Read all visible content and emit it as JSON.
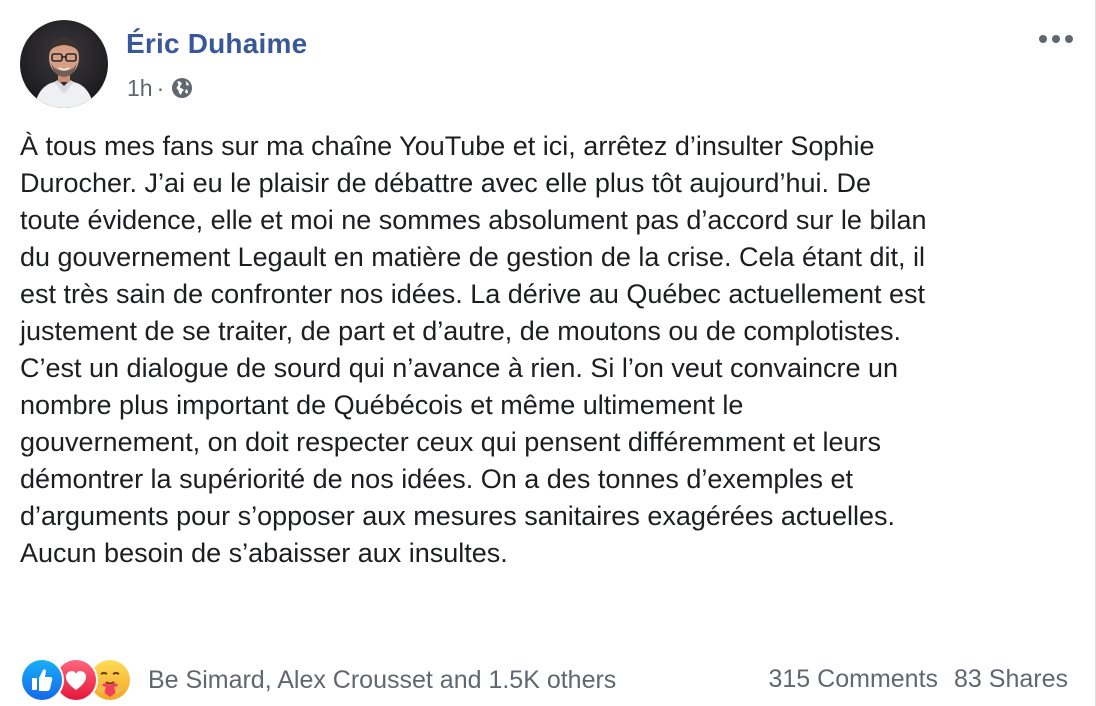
{
  "post": {
    "author": "Éric Duhaime",
    "time": "1h",
    "separator": "·",
    "privacy_icon": "globe-icon",
    "more_icon": "ellipsis-icon",
    "text": "À tous mes fans sur ma chaîne YouTube et ici, arrêtez d’insulter Sophie\nDurocher. J’ai eu le plaisir de débattre avec elle plus tôt aujourd’hui. De\ntoute évidence, elle et moi ne sommes absolument pas d’accord sur le bilan\ndu gouvernement Legault en matière de gestion de la crise. Cela étant dit, il\nest très sain de confronter nos idées. La dérive au Québec actuellement est\njustement de se traiter, de part et d’autre, de moutons ou de complotistes.\nC’est un dialogue de sourd qui n’avance à rien. Si l’on veut convaincre un\nnombre plus important de Québécois et même ultimement le\ngouvernement, on doit respecter ceux qui pensent différemment et leurs\ndémontrer la supériorité de nos idées. On a des tonnes d’exemples et\nd’arguments pour s’opposer aux mesures sanitaires exagérées actuelles.\nAucun besoin de s’abaisser aux insultes."
  },
  "footer": {
    "reaction_icons": [
      "like-icon",
      "love-icon",
      "care-icon"
    ],
    "reactions_text": "Be Simard, Alex Crousset and 1.5K others",
    "comments": "315 Comments",
    "shares": "83 Shares"
  },
  "colors": {
    "author": "#385898",
    "meta": "#616770",
    "like": "#1877f2",
    "love": "#f33e58",
    "care": "#f7b125"
  }
}
